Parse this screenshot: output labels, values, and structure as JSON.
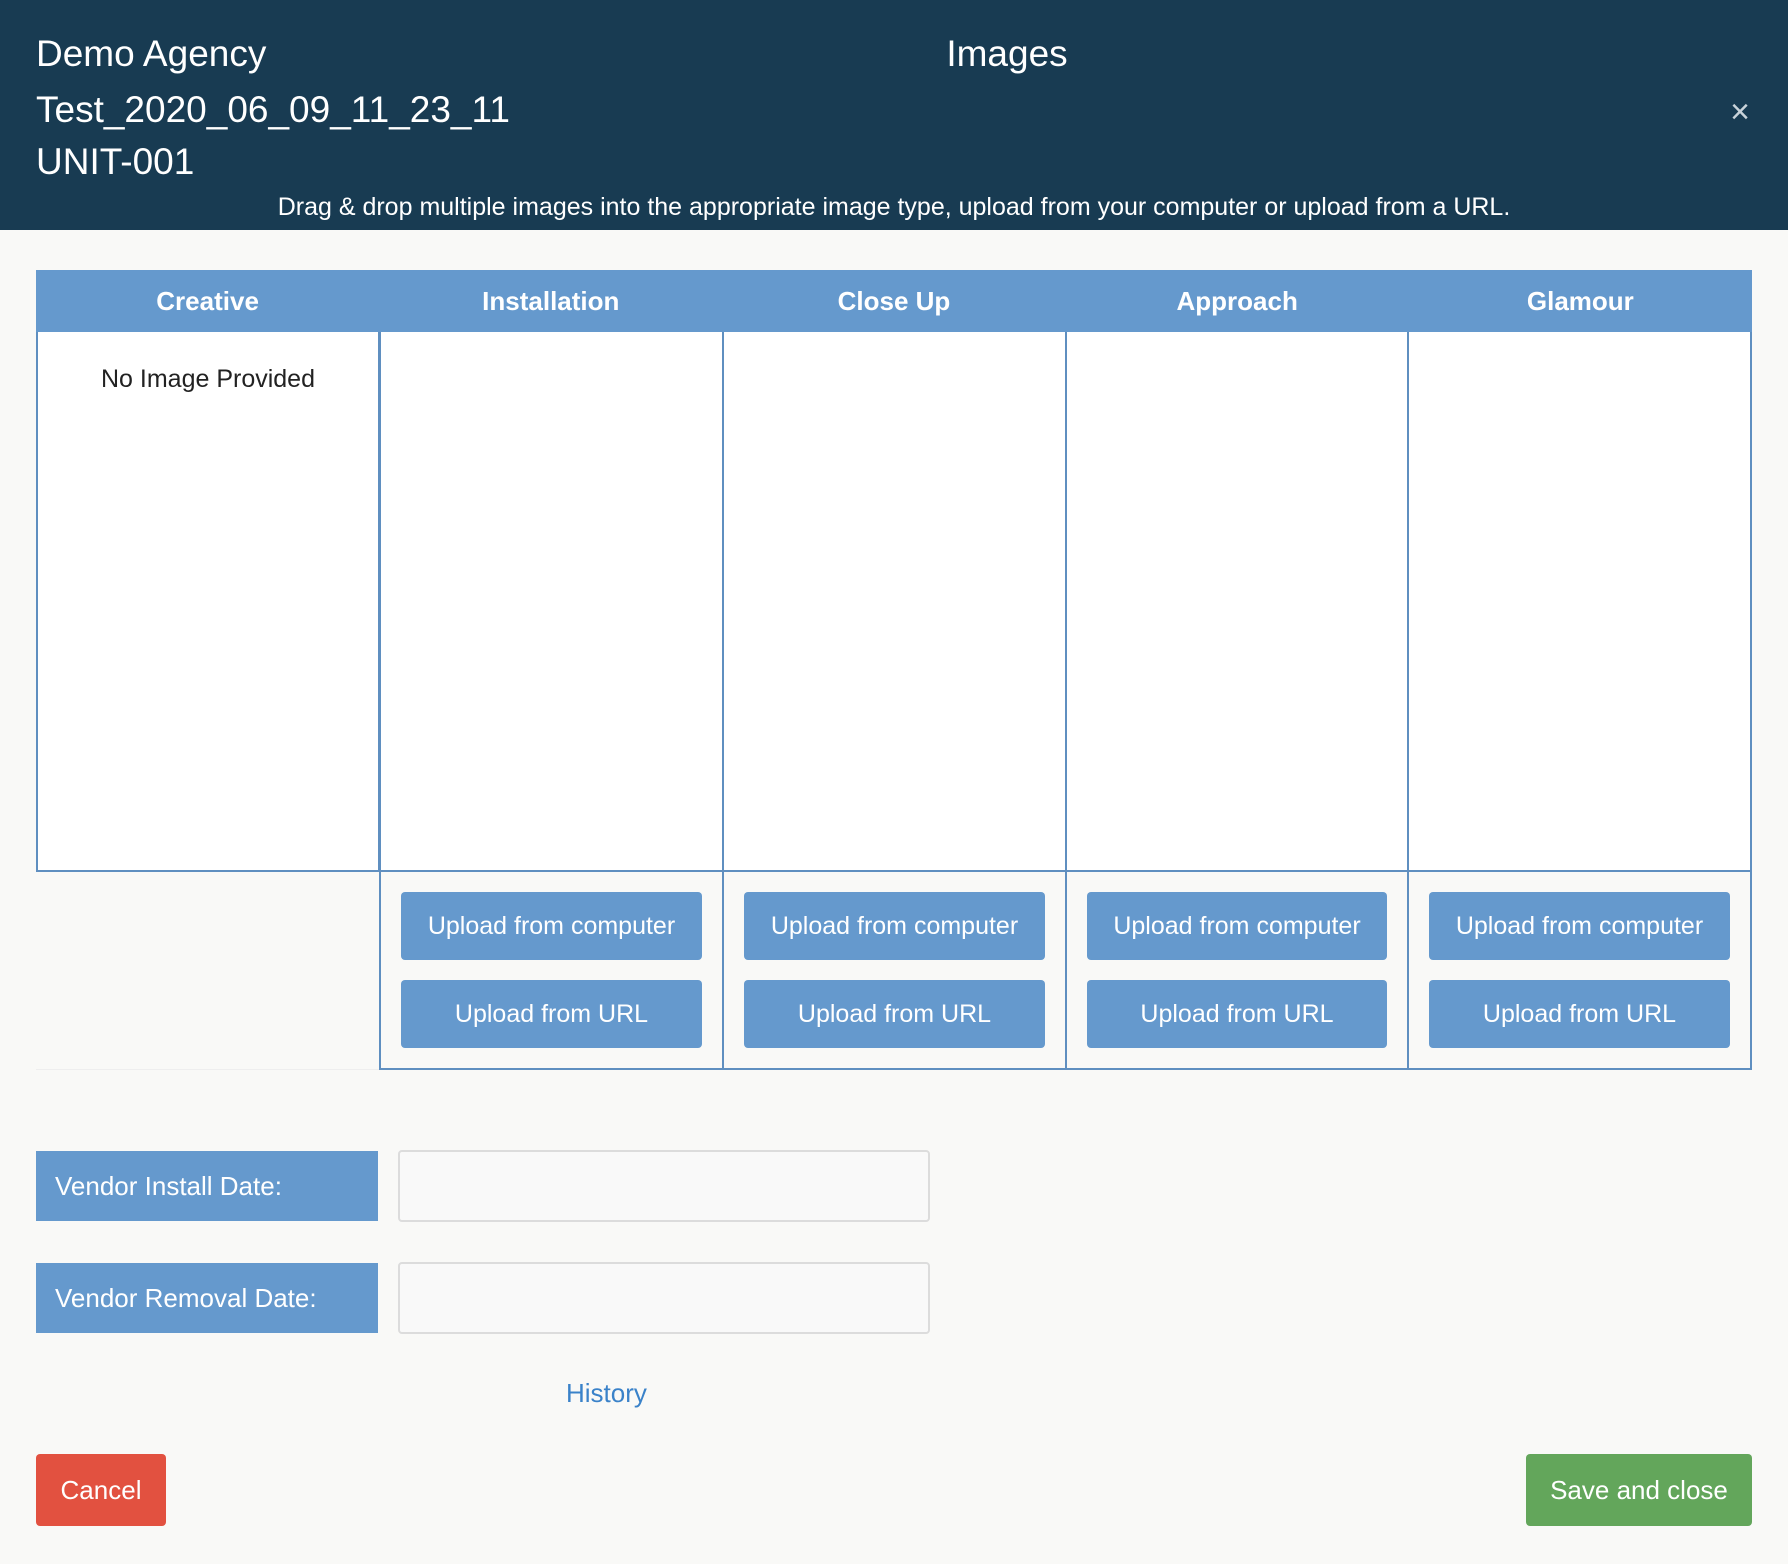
{
  "header": {
    "agency": "Demo Agency",
    "campaign": "Test_2020_06_09_11_23_11",
    "unit": "UNIT-001",
    "title": "Images",
    "close_icon": "×",
    "instructions": "Drag & drop multiple images into the appropriate image type, upload from your computer or upload from a URL."
  },
  "image_types": [
    {
      "label": "Creative",
      "content": "No Image Provided"
    },
    {
      "label": "Installation",
      "upload_computer": "Upload from computer",
      "upload_url": "Upload from URL"
    },
    {
      "label": "Close Up",
      "upload_computer": "Upload from computer",
      "upload_url": "Upload from URL"
    },
    {
      "label": "Approach",
      "upload_computer": "Upload from computer",
      "upload_url": "Upload from URL"
    },
    {
      "label": "Glamour",
      "upload_computer": "Upload from computer",
      "upload_url": "Upload from URL"
    }
  ],
  "vendor": {
    "install_label": "Vendor Install Date:",
    "install_value": "",
    "removal_label": "Vendor Removal Date:",
    "removal_value": ""
  },
  "history_link": "History",
  "actions": {
    "cancel": "Cancel",
    "save": "Save and close"
  },
  "colors": {
    "header_bg": "#183b52",
    "accent": "#6599cd",
    "cancel": "#e25140",
    "save": "#63a65b",
    "link": "#3a82c9"
  }
}
